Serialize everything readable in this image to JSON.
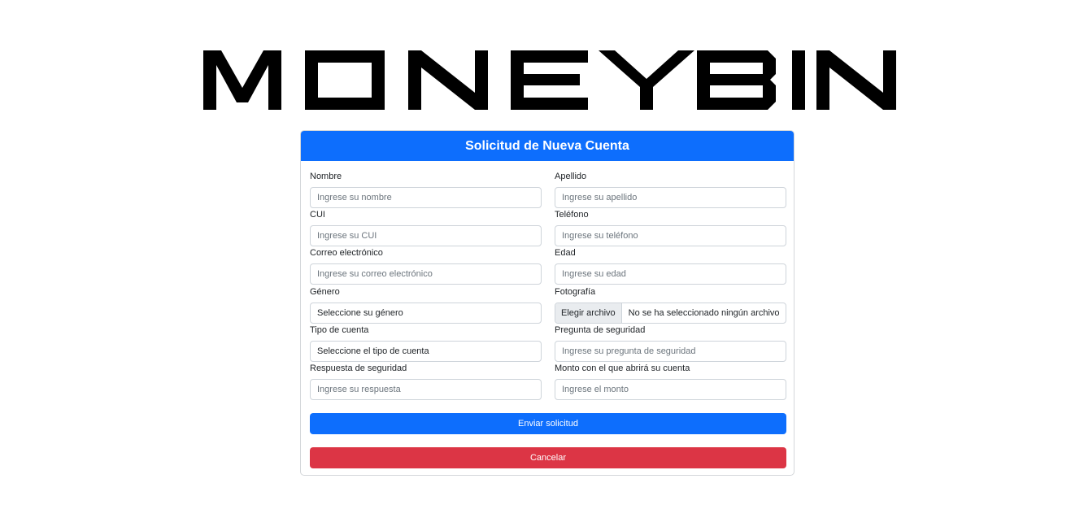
{
  "brand": {
    "logo_text": "MONEY BIN"
  },
  "form": {
    "title": "Solicitud de Nueva Cuenta",
    "fields": {
      "nombre": {
        "label": "Nombre",
        "placeholder": "Ingrese su nombre",
        "value": ""
      },
      "apellido": {
        "label": "Apellido",
        "placeholder": "Ingrese su apellido",
        "value": ""
      },
      "cui": {
        "label": "CUI",
        "placeholder": "Ingrese su CUI",
        "value": ""
      },
      "telefono": {
        "label": "Teléfono",
        "placeholder": "Ingrese su teléfono",
        "value": ""
      },
      "correo": {
        "label": "Correo electrónico",
        "placeholder": "Ingrese su correo electrónico",
        "value": ""
      },
      "edad": {
        "label": "Edad",
        "placeholder": "Ingrese su edad",
        "value": ""
      },
      "genero": {
        "label": "Género",
        "selected": "Seleccione su género"
      },
      "fotografia": {
        "label": "Fotografía",
        "button_label": "Elegir archivo",
        "status": "No se ha seleccionado ningún archivo"
      },
      "tipo_cuenta": {
        "label": "Tipo de cuenta",
        "selected": "Seleccione el tipo de cuenta"
      },
      "pregunta": {
        "label": "Pregunta de seguridad",
        "placeholder": "Ingrese su pregunta de seguridad",
        "value": ""
      },
      "respuesta": {
        "label": "Respuesta de seguridad",
        "placeholder": "Ingrese su respuesta",
        "value": ""
      },
      "monto": {
        "label": "Monto con el que abrirá su cuenta",
        "placeholder": "Ingrese el monto",
        "value": ""
      }
    },
    "submit_label": "Enviar solicitud",
    "cancel_label": "Cancelar"
  },
  "colors": {
    "primary": "#0d6efd",
    "danger": "#dc3545",
    "logo": "#000000"
  }
}
